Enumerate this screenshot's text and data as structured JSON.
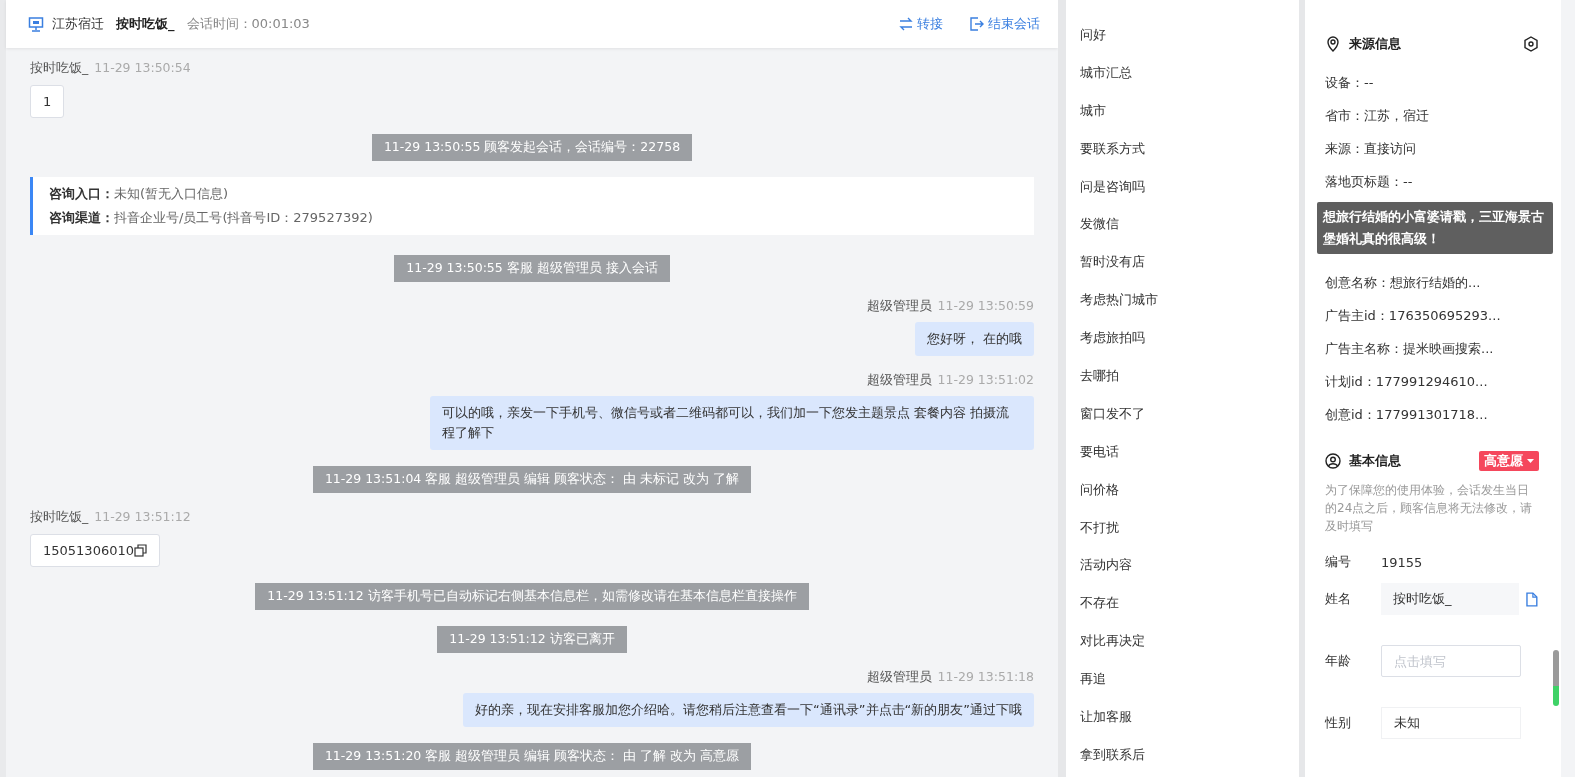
{
  "header": {
    "location": "江苏宿迁",
    "customer": "按时吃饭_",
    "timer_label": "会话时间：",
    "timer": "00:01:03",
    "actions": [
      {
        "kind": "transfer",
        "label": "转接"
      },
      {
        "kind": "end",
        "label": "结束会话"
      }
    ]
  },
  "messages": [
    {
      "kind": "customer",
      "name": "按时吃饭_",
      "time": "11-29 13:50:54",
      "text": "1",
      "copyable": false
    },
    {
      "kind": "system",
      "text": "11-29 13:50:55 顾客发起会话，会话编号：22758"
    },
    {
      "kind": "entry",
      "lines": [
        "**咨询入口：**未知(暂无入口信息)",
        "**咨询渠道：**抖音企业号/员工号(抖音号ID：279527392)"
      ]
    },
    {
      "kind": "system",
      "text": "11-29 13:50:55 客服 超级管理员 接入会话"
    },
    {
      "kind": "agent",
      "name": "超级管理员",
      "time": "11-29 13:50:59",
      "text": "您好呀， 在的哦"
    },
    {
      "kind": "agent",
      "name": "超级管理员",
      "time": "11-29 13:51:02",
      "text": "可以的哦，亲发一下手机号、微信号或者二维码都可以，我们加一下您发主题景点 套餐内容 拍摄流程了解下"
    },
    {
      "kind": "system",
      "text": "11-29 13:51:04 客服 超级管理员 编辑 顾客状态： 由 未标记 改为 了解"
    },
    {
      "kind": "customer",
      "name": "按时吃饭_",
      "time": "11-29 13:51:12",
      "text": "15051306010",
      "copyable": true
    },
    {
      "kind": "system",
      "text": "11-29 13:51:12 访客手机号已自动标记右侧基本信息栏，如需修改请在基本信息栏直接操作"
    },
    {
      "kind": "system",
      "text": "11-29 13:51:12 访客已离开"
    },
    {
      "kind": "agent",
      "name": "超级管理员",
      "time": "11-29 13:51:18",
      "text": "好的亲，现在安排客服加您介绍哈。请您稍后注意查看一下“通讯录”并点击“新的朋友”通过下哦"
    },
    {
      "kind": "system",
      "text": "11-29 13:51:20 客服 超级管理员 编辑 顾客状态： 由 了解 改为 高意愿"
    }
  ],
  "quick_replies": [
    "问好",
    "城市汇总",
    "城市",
    "要联系方式",
    "问是咨询吗",
    "发微信",
    "暂时没有店",
    "考虑热门城市",
    "考虑旅拍吗",
    "去哪拍",
    "窗口发不了",
    "要电话",
    "问价格",
    "不打扰",
    "活动内容",
    "不存在",
    "对比再决定",
    "再追",
    "让加客服",
    "拿到联系后"
  ],
  "source_info": {
    "title": "来源信息",
    "rows_before": [
      "设备：--",
      "省市：江苏，宿迁",
      "来源：直接访问",
      "落地页标题：--"
    ],
    "tooltip": "想旅行结婚的小富婆请戳，三亚海景古堡婚礼真的很高级！",
    "rows_after": [
      "创意名称：想旅行结婚的...",
      "广告主id：176350695293...",
      "广告主名称：提米映画搜索...",
      "计划id：177991294610...",
      "创意id：177991301718..."
    ]
  },
  "basic_info": {
    "title": "基本信息",
    "intent": "高意愿",
    "notice": "为了保障您的使用体验，会话发生当日的24点之后，顾客信息将无法修改，请及时填写",
    "fields": [
      {
        "kind": "text",
        "label": "编号",
        "value": "19155"
      },
      {
        "kind": "readonly",
        "label": "姓名",
        "value": "按时吃饭_"
      },
      {
        "kind": "input",
        "label": "年龄",
        "placeholder": "点击填写"
      },
      {
        "kind": "select",
        "label": "性别",
        "value": "未知"
      }
    ]
  }
}
